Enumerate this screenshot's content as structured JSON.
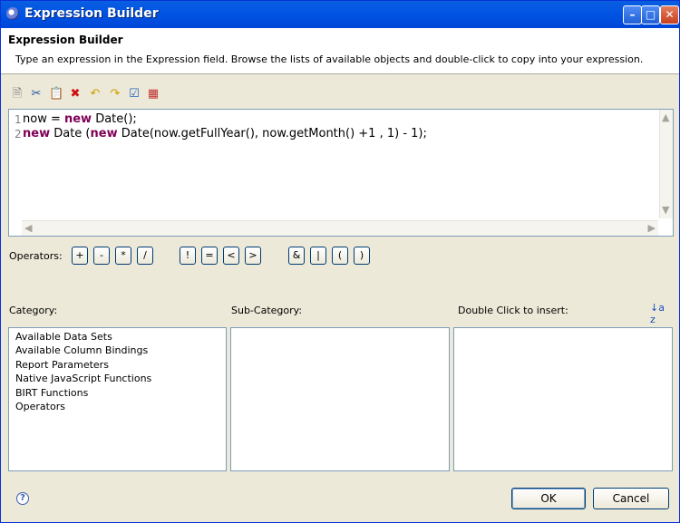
{
  "window": {
    "title": "Expression Builder"
  },
  "header": {
    "heading": "Expression Builder",
    "description": "Type an expression in the Expression field. Browse the lists of available objects and double-click to copy into your expression."
  },
  "toolbar": {
    "icons": [
      "new-document-icon",
      "cut-icon",
      "paste-icon",
      "delete-icon",
      "undo-icon",
      "redo-icon",
      "validate-icon",
      "calculator-icon"
    ]
  },
  "editor": {
    "line_numbers": [
      "1",
      "2"
    ],
    "line1": {
      "var": "now = ",
      "kw": "new",
      "rest": " Date();"
    },
    "line2": {
      "kw1": "new",
      "mid1": " Date (",
      "kw2": "new",
      "rest": " Date(now.getFullYear(), now.getMonth() +1 , 1) - 1);"
    }
  },
  "operators": {
    "label": "Operators:",
    "buttons": [
      "+",
      "-",
      "*",
      "/",
      "!",
      "=",
      "<",
      ">",
      "&",
      "|",
      "(",
      ")"
    ]
  },
  "category": {
    "label": "Category:",
    "items": [
      "Available Data Sets",
      "Available Column Bindings",
      "Report Parameters",
      "Native JavaScript Functions",
      "BIRT Functions",
      "Operators"
    ]
  },
  "subcategory": {
    "label": "Sub-Category:"
  },
  "insert": {
    "label": "Double Click to insert:"
  },
  "buttons": {
    "ok": "OK",
    "cancel": "Cancel"
  },
  "glyphs": {
    "help": "?",
    "sort": "↓a z",
    "minimize": "–",
    "maximize": "□",
    "close": "✕",
    "scroll_up": "▲",
    "scroll_down": "▼",
    "scroll_left": "◀",
    "scroll_right": "▶"
  }
}
